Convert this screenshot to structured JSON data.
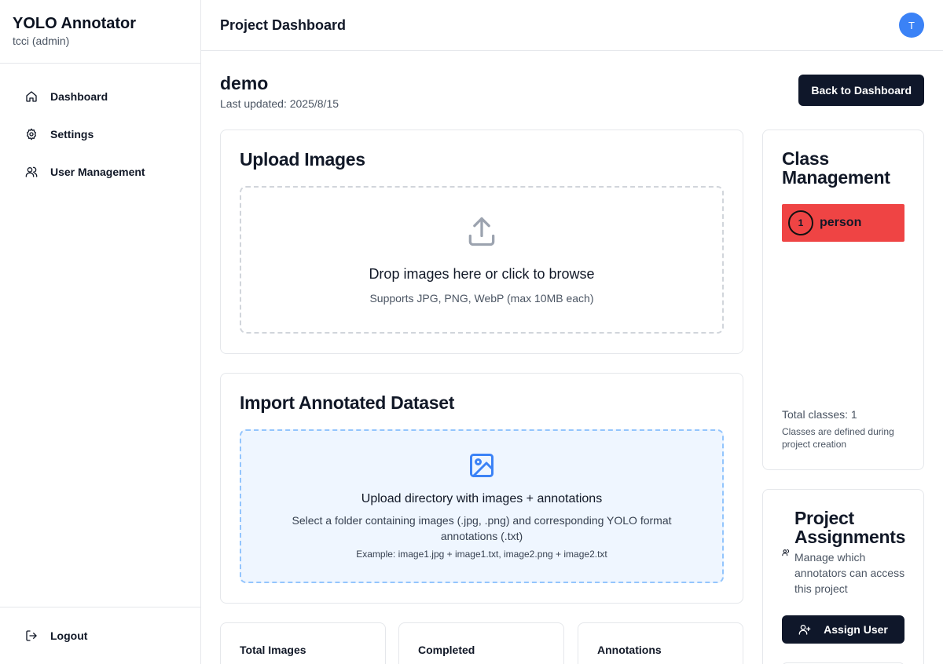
{
  "sidebar": {
    "title": "YOLO Annotator",
    "user": "tcci (admin)",
    "items": [
      {
        "label": "Dashboard",
        "icon": "home-icon"
      },
      {
        "label": "Settings",
        "icon": "gear-icon"
      },
      {
        "label": "User Management",
        "icon": "users-icon"
      }
    ],
    "logout_label": "Logout"
  },
  "header": {
    "title": "Project Dashboard",
    "avatar_initial": "T"
  },
  "project": {
    "name": "demo",
    "updated": "Last updated: 2025/8/15",
    "back_label": "Back to Dashboard"
  },
  "upload": {
    "title": "Upload Images",
    "main_text": "Drop images here or click to browse",
    "sub_text": "Supports JPG, PNG, WebP (max 10MB each)"
  },
  "import": {
    "title": "Import Annotated Dataset",
    "main_text": "Upload directory with images + annotations",
    "sub_text": "Select a folder containing images (.jpg, .png) and corresponding YOLO format annotations (.txt)",
    "example": "Example: image1.jpg + image1.txt, image2.png + image2.txt"
  },
  "stats": [
    {
      "label": "Total Images"
    },
    {
      "label": "Completed"
    },
    {
      "label": "Annotations"
    }
  ],
  "classes": {
    "title": "Class Management",
    "items": [
      {
        "number": "1",
        "name": "person",
        "color": "#ef4444"
      }
    ],
    "total": "Total classes: 1",
    "note": "Classes are defined during project creation"
  },
  "assignments": {
    "title": "Project Assignments",
    "description": "Manage which annotators can access this project",
    "assign_label": "Assign User"
  },
  "colors": {
    "primary_dark": "#0f172a",
    "accent_blue": "#3b82f6",
    "class_red": "#ef4444"
  }
}
